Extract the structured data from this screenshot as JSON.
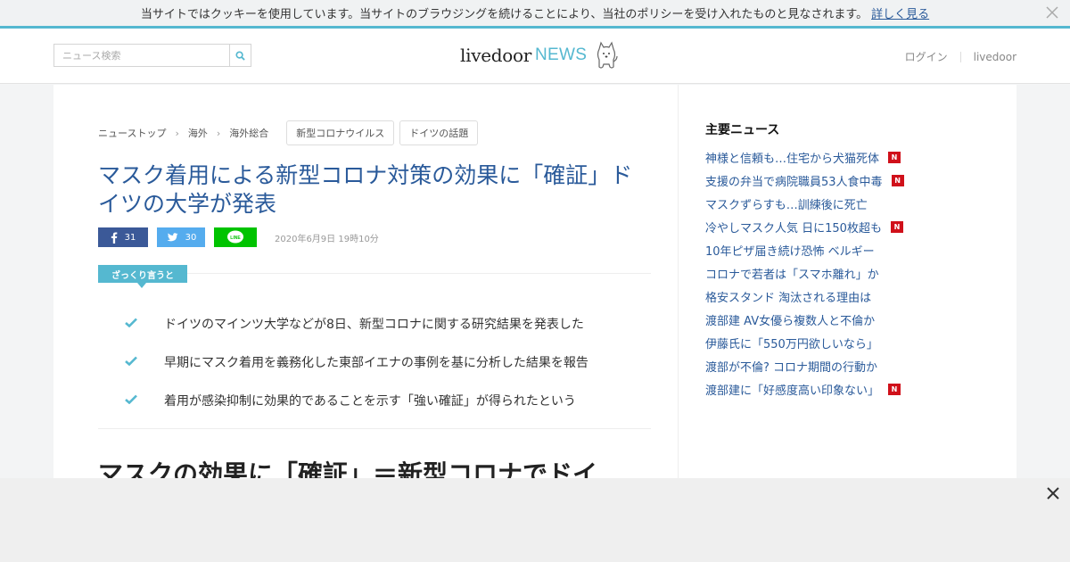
{
  "cookie": {
    "text": "当サイトではクッキーを使用しています。当サイトのブラウジングを続けることにより、当社のポリシーを受け入れたものと見なされます。",
    "link": "詳しく見る"
  },
  "header": {
    "search_placeholder": "ニュース検索",
    "logo_left": "livedoor",
    "logo_right": "NEWS",
    "login": "ログイン",
    "livedoor": "livedoor"
  },
  "breadcrumb": [
    "ニューストップ",
    "海外",
    "海外総合"
  ],
  "tags": [
    "新型コロナウイルス",
    "ドイツの話題"
  ],
  "article": {
    "title": "マスク着用による新型コロナ対策の効果に「確証」ドイツの大学が発表",
    "fb_count": "31",
    "tw_count": "30",
    "date": "2020年6月9日 19時10分",
    "zakkuri_label": "ざっくり言うと",
    "summary": [
      "ドイツのマインツ大学などが8日、新型コロナに関する研究結果を発表した",
      "早期にマスク着用を義務化した東部イエナの事例を基に分析した結果を報告",
      "着用が感染抑制に効果的であることを示す「強い確証」が得られたという"
    ],
    "sub_heading": "マスクの効果に「確証」＝新型コロナでドイ"
  },
  "side": {
    "title": "主要ニュース",
    "news": [
      {
        "text": "神様と信頼も…住宅から犬猫死体",
        "new": true
      },
      {
        "text": "支援の弁当で病院職員53人食中毒",
        "new": true
      },
      {
        "text": "マスクずらすも…訓練後に死亡",
        "new": false
      },
      {
        "text": "冷やしマスク人気 日に150枚超も",
        "new": true
      },
      {
        "text": "10年ピザ届き続け恐怖 ベルギー",
        "new": false
      },
      {
        "text": "コロナで若者は「スマホ離れ」か",
        "new": false
      },
      {
        "text": "格安スタンド 淘汰される理由は",
        "new": false
      },
      {
        "text": "渡部建 AV女優ら複数人と不倫か",
        "new": false
      },
      {
        "text": "伊藤氏に「550万円欲しいなら」",
        "new": false
      },
      {
        "text": "渡部が不倫? コロナ期間の行動か",
        "new": false
      },
      {
        "text": "渡部建に「好感度高い印象ない」",
        "new": true
      }
    ],
    "new_badge": "N"
  },
  "colors": {
    "accent": "#55b8d0",
    "link": "#2a5a9a",
    "facebook": "#3b5998",
    "twitter": "#55acee",
    "line": "#00c300",
    "new_badge": "#d0101a"
  }
}
